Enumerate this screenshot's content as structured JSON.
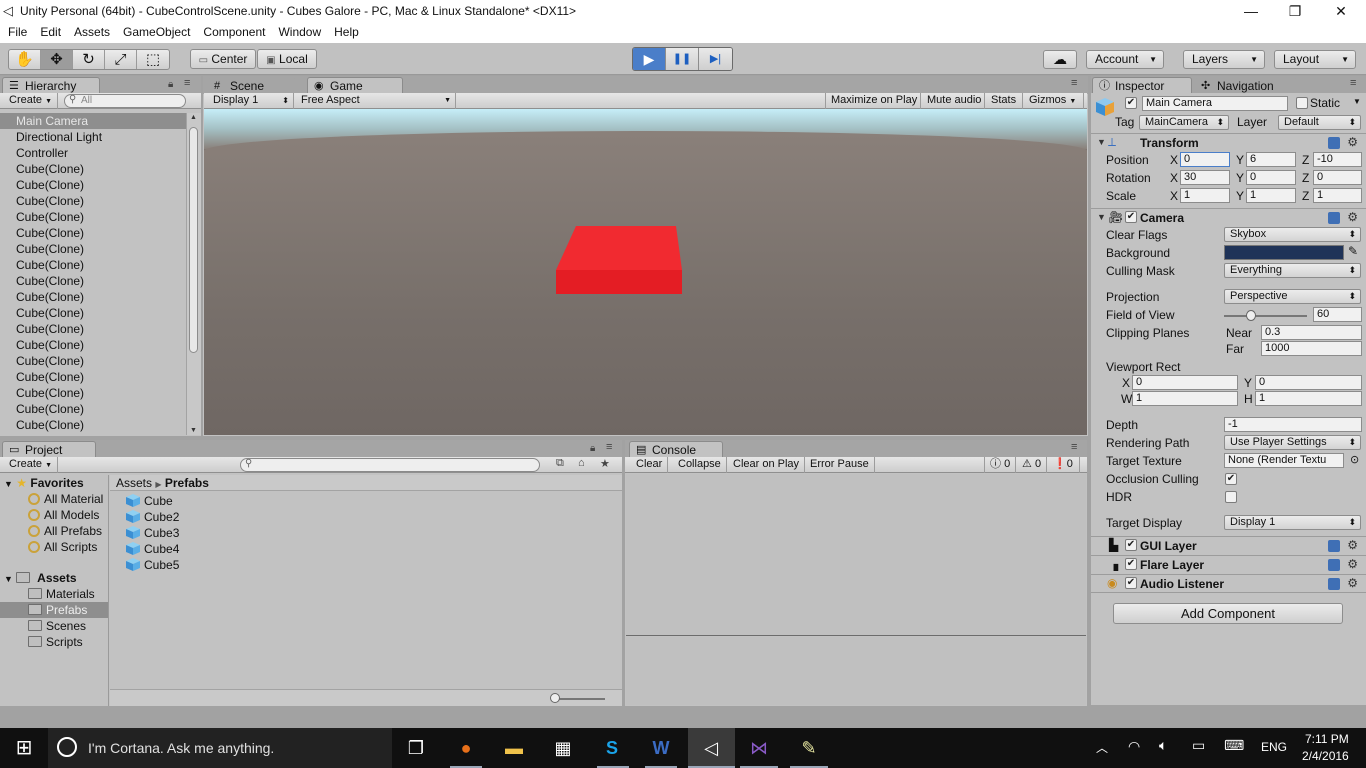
{
  "window": {
    "title": "Unity Personal (64bit) - CubeControlScene.unity - Cubes Galore - PC, Mac & Linux Standalone* <DX11>",
    "controls": {
      "minimize": "—",
      "restore": "❐",
      "close": "✕"
    }
  },
  "menu": [
    "File",
    "Edit",
    "Assets",
    "GameObject",
    "Component",
    "Window",
    "Help"
  ],
  "toolbar": {
    "tools": [
      {
        "name": "hand-tool",
        "icon": "✋"
      },
      {
        "name": "move-tool",
        "icon": "✥"
      },
      {
        "name": "rotate-tool",
        "icon": "↻"
      },
      {
        "name": "scale-tool",
        "icon": "⤢"
      },
      {
        "name": "rect-tool",
        "icon": "⬚"
      }
    ],
    "pivot": "Center",
    "space": "Local",
    "play": "▶",
    "pause": "❚❚",
    "step": "▶|",
    "cloud": "☁",
    "account": "Account",
    "layers": "Layers",
    "layout": "Layout"
  },
  "hierarchy": {
    "tab": "Hierarchy",
    "create": "Create",
    "search_placeholder": "All",
    "items": [
      "Main Camera",
      "Directional Light",
      "Controller",
      "Cube(Clone)",
      "Cube(Clone)",
      "Cube(Clone)",
      "Cube(Clone)",
      "Cube(Clone)",
      "Cube(Clone)",
      "Cube(Clone)",
      "Cube(Clone)",
      "Cube(Clone)",
      "Cube(Clone)",
      "Cube(Clone)",
      "Cube(Clone)",
      "Cube(Clone)",
      "Cube(Clone)",
      "Cube(Clone)",
      "Cube(Clone)",
      "Cube(Clone)"
    ],
    "selected_index": 0
  },
  "center_tabs": {
    "scene": "Scene",
    "game": "Game"
  },
  "game_bar": {
    "display": "Display 1",
    "aspect": "Free Aspect",
    "maximize": "Maximize on Play",
    "mute": "Mute audio",
    "stats": "Stats",
    "gizmos": "Gizmos"
  },
  "project": {
    "tab": "Project",
    "create": "Create",
    "favorites_label": "Favorites",
    "favorites": [
      "All Material",
      "All Models",
      "All Prefabs",
      "All Scripts"
    ],
    "assets_label": "Assets",
    "folders": [
      "Materials",
      "Prefabs",
      "Scenes",
      "Scripts"
    ],
    "selected_folder": "Prefabs",
    "breadcrumb": [
      "Assets",
      "Prefabs"
    ],
    "files": [
      "Cube",
      "Cube2",
      "Cube3",
      "Cube4",
      "Cube5"
    ]
  },
  "console": {
    "tab": "Console",
    "buttons": [
      "Clear",
      "Collapse",
      "Clear on Play",
      "Error Pause"
    ],
    "counts": {
      "info": "0",
      "warn": "0",
      "error": "0"
    }
  },
  "inspector": {
    "tab": "Inspector",
    "nav_tab": "Navigation",
    "object_name": "Main Camera",
    "static_label": "Static",
    "tag_label": "Tag",
    "tag": "MainCamera",
    "layer_label": "Layer",
    "layer": "Default",
    "transform": {
      "title": "Transform",
      "position_label": "Position",
      "position": {
        "x": "0",
        "y": "6",
        "z": "-10"
      },
      "rotation_label": "Rotation",
      "rotation": {
        "x": "30",
        "y": "0",
        "z": "0"
      },
      "scale_label": "Scale",
      "scale": {
        "x": "1",
        "y": "1",
        "z": "1"
      }
    },
    "camera": {
      "title": "Camera",
      "clear_flags_label": "Clear Flags",
      "clear_flags": "Skybox",
      "background_label": "Background",
      "background_color": "#1f3358",
      "culling_mask_label": "Culling Mask",
      "culling_mask": "Everything",
      "projection_label": "Projection",
      "projection": "Perspective",
      "fov_label": "Field of View",
      "fov": "60",
      "fov_fraction": 0.33,
      "clipping_label": "Clipping Planes",
      "near_label": "Near",
      "near": "0.3",
      "far_label": "Far",
      "far": "1000",
      "viewport_label": "Viewport Rect",
      "vp": {
        "x": "0",
        "y": "0",
        "w": "1",
        "h": "1"
      },
      "depth_label": "Depth",
      "depth": "-1",
      "rendering_path_label": "Rendering Path",
      "rendering_path": "Use Player Settings",
      "target_texture_label": "Target Texture",
      "target_texture": "None (Render Textu",
      "occlusion_label": "Occlusion Culling",
      "hdr_label": "HDR",
      "target_display_label": "Target Display",
      "target_display": "Display 1"
    },
    "components": [
      "GUI Layer",
      "Flare Layer",
      "Audio Listener"
    ],
    "add_component": "Add Component"
  },
  "taskbar": {
    "cortana": "I'm Cortana. Ask me anything.",
    "lang": "ENG",
    "time": "7:11 PM",
    "date": "2/4/2016"
  },
  "colors": {
    "cube_red": "#f2232b",
    "play_blue": "#4a7ec9",
    "selection_gray": "#8e8e8e"
  }
}
